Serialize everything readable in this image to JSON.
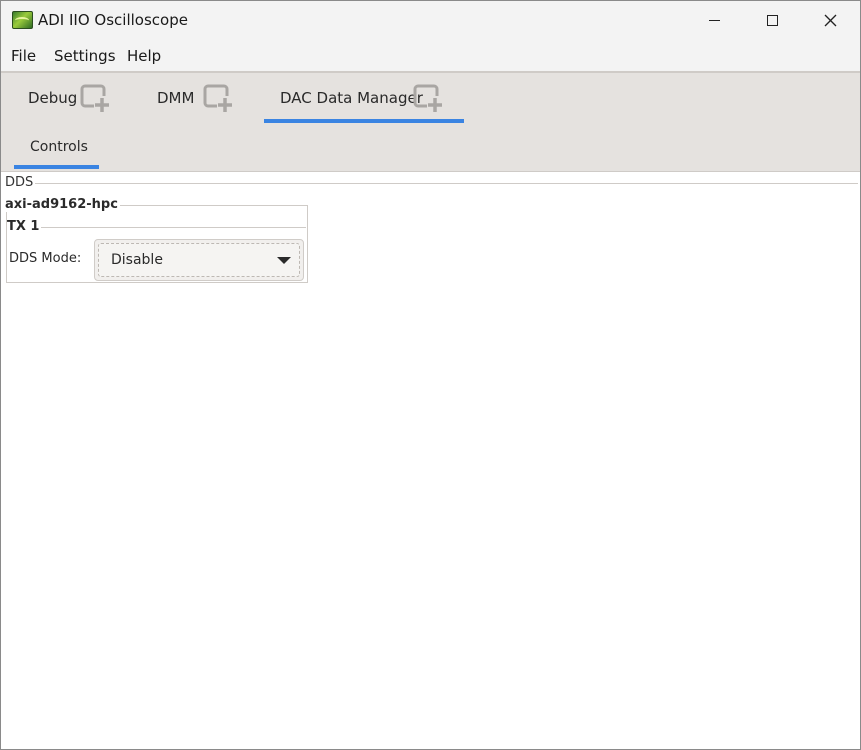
{
  "window": {
    "title": "ADI IIO Oscilloscope"
  },
  "menu": {
    "file": "File",
    "settings": "Settings",
    "help": "Help"
  },
  "tabs": [
    {
      "label": "Debug",
      "active": false
    },
    {
      "label": "DMM",
      "active": false
    },
    {
      "label": "DAC Data Manager",
      "active": true
    }
  ],
  "subtabs": [
    {
      "label": "Controls",
      "active": true
    }
  ],
  "content": {
    "section_label": "DDS",
    "device_label": "axi-ad9162-hpc",
    "channel_label": "TX 1",
    "dds_mode_label": "DDS Mode:",
    "dds_mode_value": "Disable"
  },
  "colors": {
    "accent": "#3a84e2",
    "tabbar_bg": "#e5e2df"
  }
}
